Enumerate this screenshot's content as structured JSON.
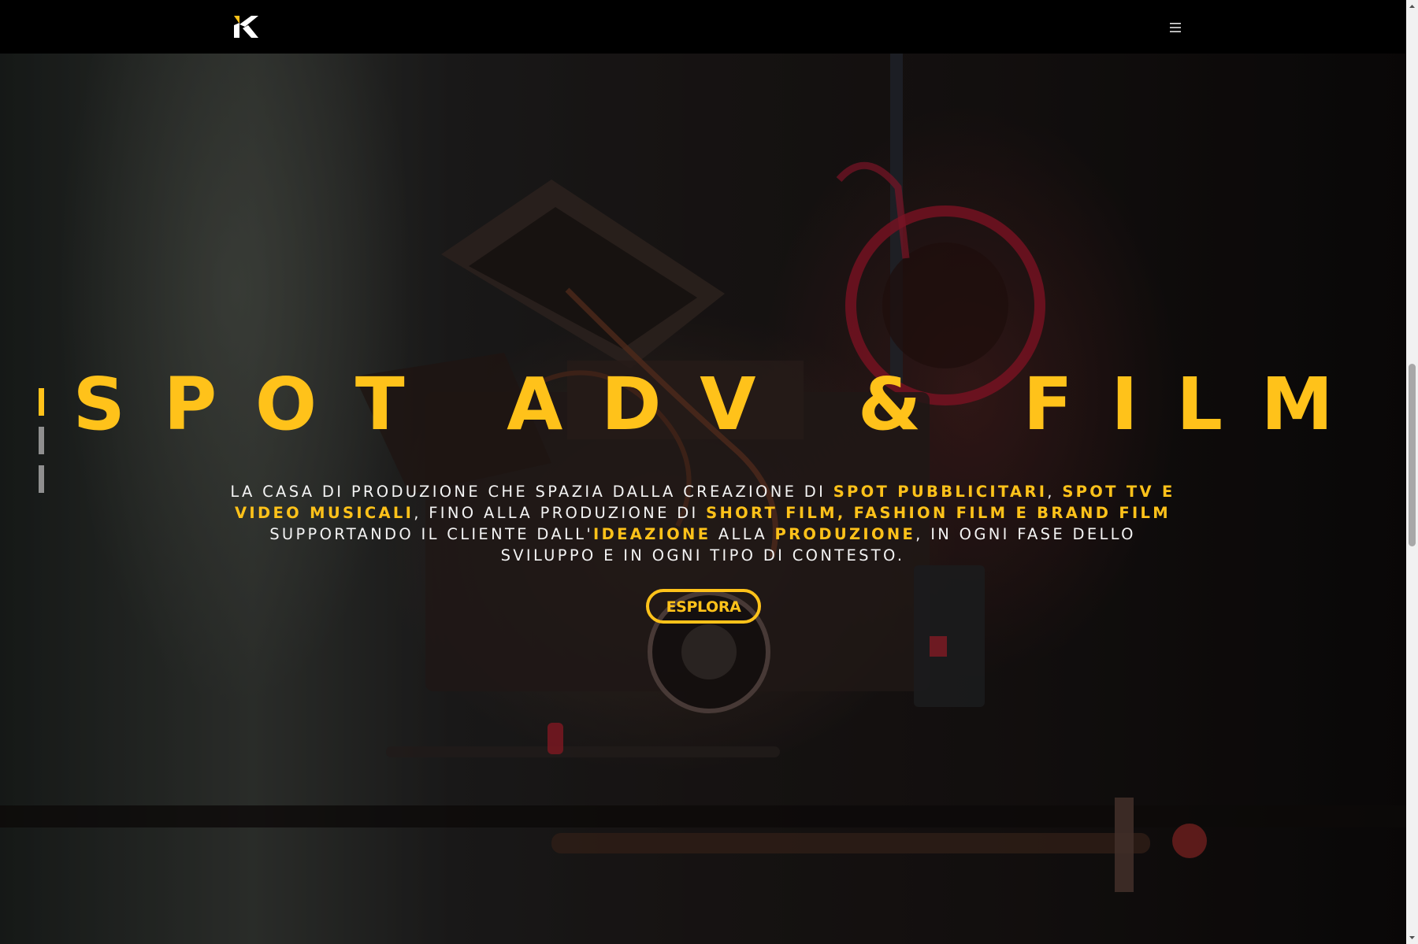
{
  "header": {
    "logo_label": "K",
    "menu_icon": "hamburger-menu-icon"
  },
  "hero": {
    "title": "SPOT ADV & FILM",
    "description": {
      "p1": "LA CASA DI PRODUZIONE CHE SPAZIA DALLA CREAZIONE DI ",
      "h1": "SPOT PUBBLICITARI",
      "p2": ", ",
      "h2": "SPOT TV E VIDEO MUSICALI",
      "p3": ", FINO ALLA PRODUZIONE DI ",
      "h3": "SHORT FILM, FASHION FILM E BRAND FILM",
      "p4": " SUPPORTANDO IL CLIENTE DALL'",
      "h4": "IDEAZIONE",
      "p5": " ALLA ",
      "h5": "PRODUZIONE",
      "p6": ", IN OGNI FASE DELLO SVILUPPO E IN OGNI TIPO DI CONTESTO."
    },
    "cta_label": "ESPLORA"
  },
  "slider": {
    "total_slides": 3,
    "active_slide": 1
  },
  "colors": {
    "accent": "#ffc21a",
    "background": "#000000",
    "text": "#f3f3f3",
    "inactive_dot": "#8f8f8f"
  }
}
